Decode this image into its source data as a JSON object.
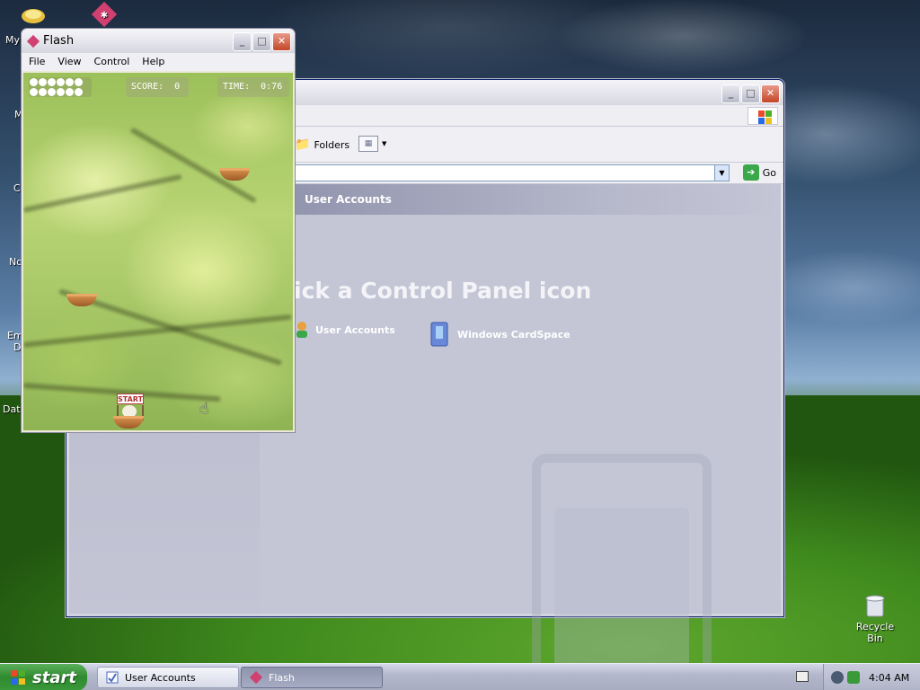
{
  "desktop": {
    "icons": [
      {
        "name": "my-documents-icon",
        "label": "My"
      },
      {
        "name": "partial-icon-m",
        "label": "M"
      },
      {
        "name": "partial-icon-c",
        "label": "C"
      },
      {
        "name": "partial-icon-no",
        "label": "No"
      },
      {
        "name": "partial-icon-em",
        "label": "Em"
      },
      {
        "name": "partial-icon-d",
        "label": "D"
      },
      {
        "name": "partial-icon-dat",
        "label": "Dat"
      }
    ],
    "recycle_bin_label": "Recycle Bin"
  },
  "control_panel": {
    "toolbar": {
      "folders_label": "Folders"
    },
    "address": {
      "go_label": "Go"
    },
    "header_title": "User Accounts",
    "pick_text": "ick a Control Panel icon",
    "items": [
      {
        "label": "User Accounts",
        "icon": "user-accounts-icon"
      },
      {
        "label": "Windows CardSpace",
        "icon": "cardspace-icon"
      }
    ]
  },
  "flash": {
    "title": "Flash",
    "menu": [
      "File",
      "View",
      "Control",
      "Help"
    ],
    "score_label": "SCORE:",
    "score_value": "0",
    "time_label": "TIME:",
    "time_value": "0:76",
    "eggs_remaining": 12,
    "start_label": "START"
  },
  "taskbar": {
    "start_label": "start",
    "tasks": [
      {
        "label": "User Accounts",
        "active": false
      },
      {
        "label": "Flash",
        "active": true
      }
    ],
    "clock": "4:04 AM"
  },
  "colors": {
    "start_green": "#3a9a3a",
    "title_close_red": "#c44628",
    "cp_body": "#c4c6d6"
  }
}
